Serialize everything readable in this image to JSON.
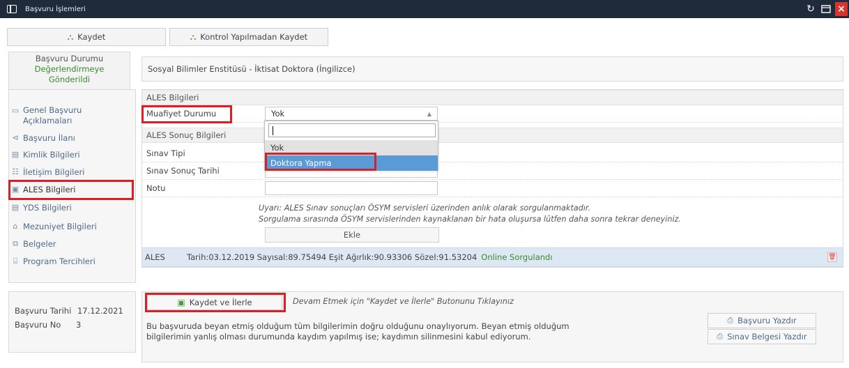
{
  "window": {
    "title": "Başvuru İşlemleri",
    "icon": "window-icon",
    "controls": [
      "refresh-icon",
      "maximize-icon",
      "close-icon"
    ]
  },
  "toolbar": {
    "save_label": "Kaydet",
    "save_unchecked_label": "Kontrol Yapılmadan Kaydet"
  },
  "status": {
    "line1": "Başvuru Durumu",
    "line2": "Değerlendirmeye",
    "line3": "Gönderildi"
  },
  "program": {
    "name": "Sosyal Bilimler Enstitüsü - İktisat Doktora (İngilizce)"
  },
  "sidebar": {
    "items": [
      {
        "label_l1": "Genel Başvuru",
        "label_l2": "Açıklamaları",
        "icon": "document-icon"
      },
      {
        "label": "Başvuru İlanı",
        "icon": "megaphone-icon"
      },
      {
        "label": "Kimlik Bilgileri",
        "icon": "id-card-icon"
      },
      {
        "label": "İletişim Bilgileri",
        "icon": "contacts-icon"
      },
      {
        "label": "ALES Bilgileri",
        "icon": "list-icon"
      },
      {
        "label": "YDS Bilgileri",
        "icon": "list-icon"
      },
      {
        "label": "Mezuniyet Bilgileri",
        "icon": "graduation-icon"
      },
      {
        "label": "Belgeler",
        "icon": "files-icon"
      },
      {
        "label": "Program Tercihleri",
        "icon": "institution-icon"
      }
    ]
  },
  "ales": {
    "section_title": "ALES Bilgileri",
    "exemption_label": "Muafiyet Durumu",
    "exemption_value": "Yok",
    "results_title": "ALES Sonuç Bilgileri",
    "exam_type_label": "Sınav Tipi",
    "exam_date_label": "Sınav Sonuç Tarihi",
    "grade_label": "Notu",
    "warning_l1": "Uyarı: ALES Sınav sonuçları ÖSYM servisleri üzerinden anlık olarak sorgulanmaktadır.",
    "warning_l2": "Sorgulama sırasında ÖSYM servislerinden kaynaklanan bir hata oluşursa lütfen daha sonra tekrar deneyiniz.",
    "add_label": "Ekle",
    "dropdown_options": [
      "Yok",
      "Doktora Yapma"
    ],
    "result": {
      "tag": "ALES",
      "text": "Tarih:03.12.2019  Sayısal:89.75494  Eşit Ağırlık:90.93306  Sözel:91.53204",
      "status": "Online Sorgulandı"
    }
  },
  "application": {
    "date_label": "Başvuru Tarihi",
    "date_value": "17.12.2021",
    "no_label": "Başvuru No",
    "no_value": "3"
  },
  "footer": {
    "save_next_label": "Kaydet ve İlerle",
    "hint": "Devam Etmek için \"Kaydet ve İlerle\" Butonunu Tıklayınız",
    "consent_l1": "Bu başvuruda beyan etmiş olduğum tüm bilgilerimin doğru olduğunu onaylıyorum. Beyan etmiş olduğum",
    "consent_l2": "bilgilerimin yanlış olması durumunda kaydım yapılmış ise; kaydımın silinmesini kabul ediyorum.",
    "print_application_label": "Başvuru Yazdır",
    "print_exam_label": "Sınav Belgesi Yazdır"
  },
  "colors": {
    "titlebar": "#1f2a3a",
    "highlight": "#d92027",
    "selected_option": "#5b9bd5",
    "status_green": "#3a8a2e",
    "result_bg": "#dde8f4"
  }
}
